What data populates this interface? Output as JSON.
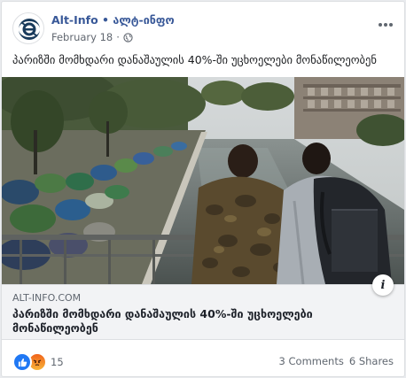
{
  "post": {
    "page_name": "Alt-Info",
    "separator": " • ",
    "page_alt_name": "ალტ-ინფო",
    "date": "February 18",
    "privacy_icon": "globe-icon",
    "more_icon": "ellipsis-icon",
    "text": "პარიზში მომხდარი დანაშაულის 40%-ში უცხოელები მონაწილეობენ"
  },
  "link_preview": {
    "domain": "ALT-INFO.COM",
    "title": "პარიზში მომხდარი დანაშაულის 40%-ში უცხოელები მონაწილეობენ",
    "info_label": "i"
  },
  "footer": {
    "reaction_icons": [
      "like-icon",
      "angry-icon"
    ],
    "reaction_count": "15",
    "comments": "3 Comments",
    "shares": "6 Shares"
  },
  "colors": {
    "brand_link": "#385898",
    "like_blue": "#2078f4",
    "link_bg": "#f2f3f5"
  }
}
